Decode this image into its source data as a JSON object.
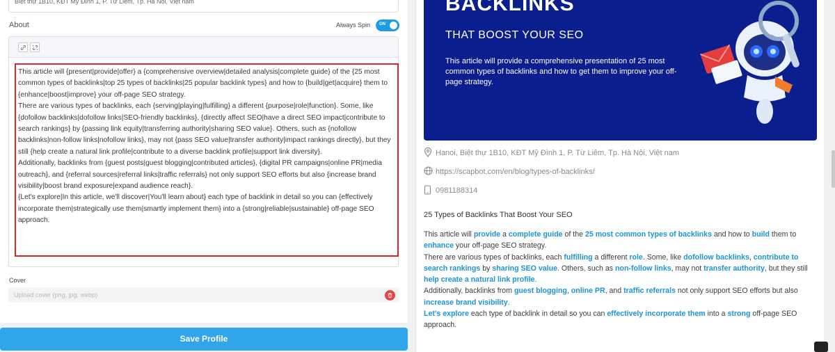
{
  "left": {
    "address_value": "Biệt thự 1B10, KĐT Mỹ Đình 1, P. Từ Liêm, Tp. Hà Nội, Việt nam",
    "about_label": "About",
    "always_spin_label": "Always Spin",
    "toggle": {
      "text": "ON",
      "on": true
    },
    "toolbar_icons": [
      "link-icon",
      "unlink-icon"
    ],
    "editor_paragraphs": [
      "This article will {present|provide|offer} a {comprehensive overview|detailed analysis|complete guide} of the {25 most common types of backlinks|top 25 types of backlinks|25 popular backlink types} and how to {build|get|acquire} them to {enhance|boost|improve} your off-page SEO strategy.",
      "There are various types of backlinks, each {serving|playing|fulfilling} a different {purpose|role|function}. Some, like {dofollow backlinks|dofollow links|SEO-friendly backlinks}, {directly affect SEO|have a direct SEO impact|contribute to search rankings} by {passing link equity|transferring authority|sharing SEO value}. Others, such as {nofollow backlinks|non-follow links|nofollow links}, may not {pass SEO value|transfer authority|impact rankings directly}, but they still {help create a natural link profile|contribute to a diverse backlink profile|support link diversity}.",
      "Additionally, backlinks from {guest posts|guest blogging|contributed articles}, {digital PR campaigns|online PR|media outreach}, and {referral sources|referral links|traffic referrals} not only support SEO efforts but also {increase brand visibility|boost brand exposure|expand audience reach}.",
      "{Let's explore|In this article, we'll discover|You'll learn about} each type of backlink in detail so you can {effectively incorporate them|strategically use them|smartly implement them} into a {strong|reliable|sustainable} off-page SEO approach."
    ],
    "cover_label": "Cover",
    "cover_placeholder": "Upload cover (png, jpg, webp)",
    "save_label": "Save Profile"
  },
  "right": {
    "banner": {
      "headline": "BACKLINKS",
      "subheadline": "THAT BOOST YOUR SEO",
      "description": "This article will provide a comprehensive presentation of 25 most common types of backlinks and how to get them to improve your off-page strategy."
    },
    "address": "Hanoi, Biệt thự 1B10, KĐT Mỹ Đình 1, P. Từ Liêm, Tp. Hà Nội, Việt nam",
    "website": "https://scapbot.com/en/blog/types-of-backlinks/",
    "phone": "0981188314",
    "title": "25 Types of Backlinks That Boost Your SEO",
    "paragraphs": [
      [
        {
          "t": "This article will "
        },
        {
          "t": "provide",
          "k": true
        },
        {
          "t": " a "
        },
        {
          "t": "complete guide",
          "k": true
        },
        {
          "t": " of the "
        },
        {
          "t": "25 most common types of backlinks",
          "k": true
        },
        {
          "t": " and how to "
        },
        {
          "t": "build",
          "k": true
        },
        {
          "t": " them to "
        },
        {
          "t": "enhance",
          "k": true
        },
        {
          "t": " your off-page SEO strategy."
        }
      ],
      [
        {
          "t": "There are various types of backlinks, each "
        },
        {
          "t": "fulfilling",
          "k": true
        },
        {
          "t": " a different "
        },
        {
          "t": "role",
          "k": true
        },
        {
          "t": ". Some, like "
        },
        {
          "t": "dofollow backlinks",
          "k": true
        },
        {
          "t": ", "
        },
        {
          "t": "contribute to search rankings",
          "k": true
        },
        {
          "t": " by "
        },
        {
          "t": "sharing SEO value",
          "k": true
        },
        {
          "t": ". Others, such as "
        },
        {
          "t": "non-follow links",
          "k": true
        },
        {
          "t": ", may not "
        },
        {
          "t": "transfer authority",
          "k": true
        },
        {
          "t": ", but they still "
        },
        {
          "t": "help create a natural link profile",
          "k": true
        },
        {
          "t": "."
        }
      ],
      [
        {
          "t": "Additionally, backlinks from "
        },
        {
          "t": "guest blogging",
          "k": true
        },
        {
          "t": ", "
        },
        {
          "t": "online PR",
          "k": true
        },
        {
          "t": ", and "
        },
        {
          "t": "traffic referrals",
          "k": true
        },
        {
          "t": " not only support SEO efforts but also "
        },
        {
          "t": "increase brand visibility",
          "k": true
        },
        {
          "t": "."
        }
      ],
      [
        {
          "t": "Let's explore",
          "k": true
        },
        {
          "t": " each type of backlink in detail so you can "
        },
        {
          "t": "effectively incorporate them",
          "k": true
        },
        {
          "t": " into a "
        },
        {
          "t": "strong",
          "k": true
        },
        {
          "t": " off-page SEO approach."
        }
      ]
    ]
  },
  "colors": {
    "accent": "#31a5ec",
    "toggle": "#1e9be6",
    "keyword": "#1b95d6",
    "banner": "#0b1e8e",
    "highlight_border": "#d9262c",
    "delete": "#e04848"
  },
  "icons": {
    "address": "map-pin-icon",
    "website": "globe-icon",
    "phone": "phone-icon",
    "cover_delete": "trash-icon"
  }
}
